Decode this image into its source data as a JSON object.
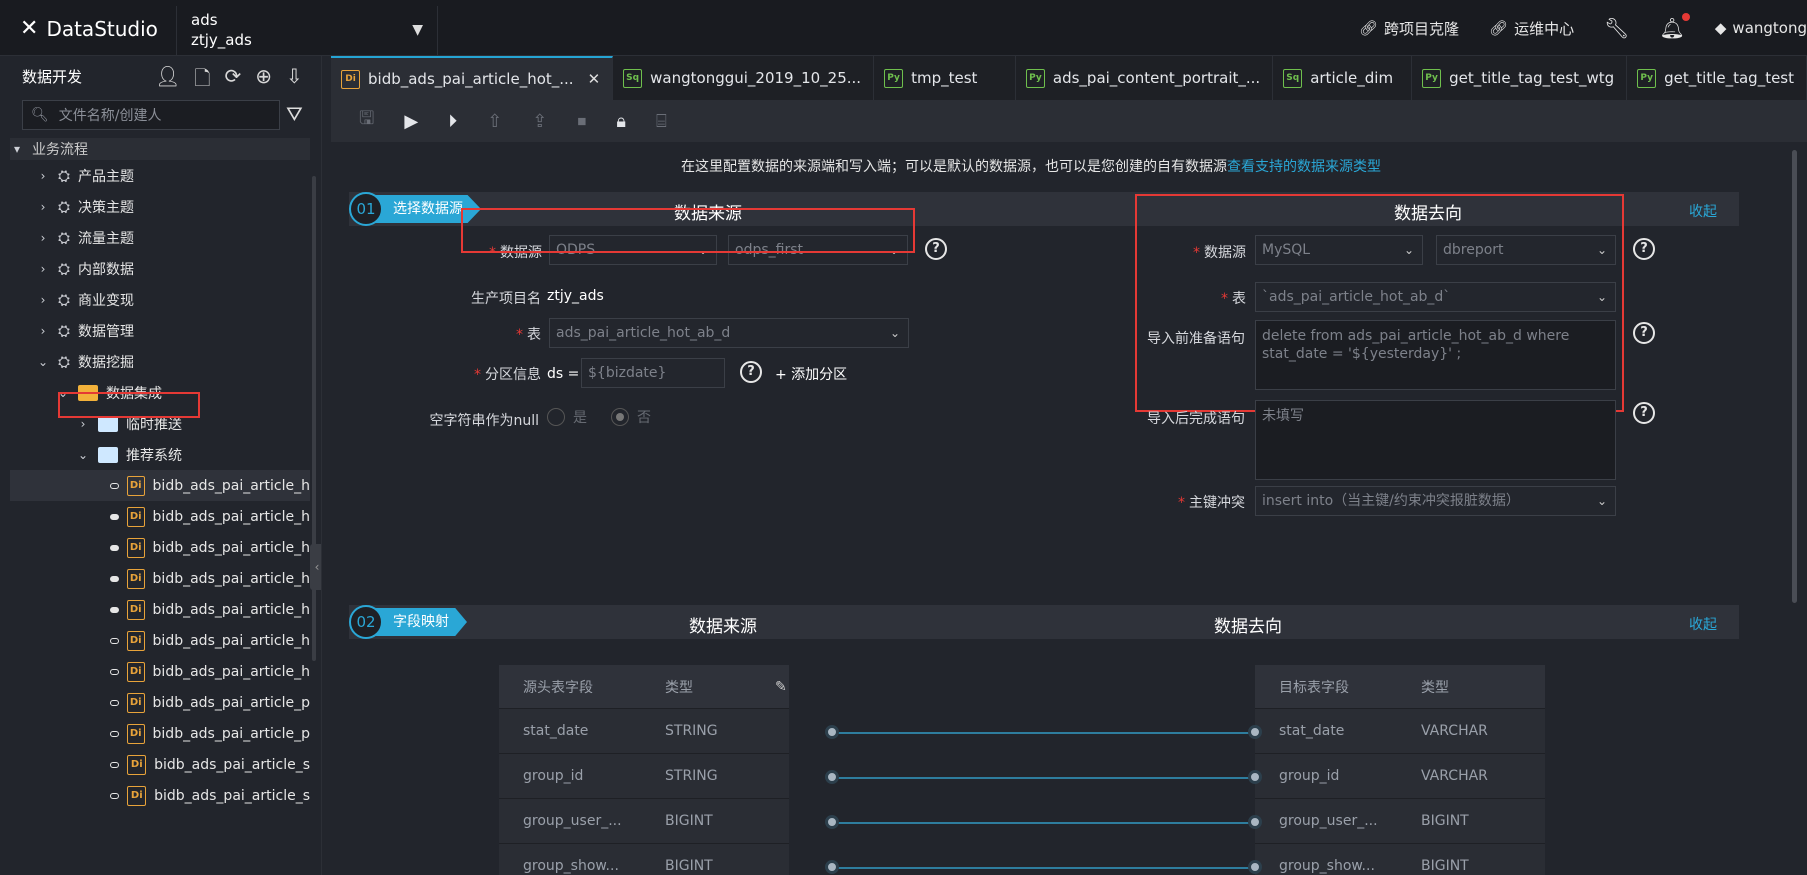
{
  "app": {
    "name": "DataStudio"
  },
  "project": {
    "line1": "ads",
    "line2": "ztjy_ads"
  },
  "topnav": {
    "clone": "跨项目克隆",
    "ops": "运维中心",
    "user": "wangtong"
  },
  "sidebar": {
    "title": "数据开发",
    "search_placeholder": "文件名称/创建人",
    "section": "业务流程",
    "items": [
      {
        "label": "产品主题"
      },
      {
        "label": "决策主题"
      },
      {
        "label": "流量主题"
      },
      {
        "label": "内部数据"
      },
      {
        "label": "商业变现"
      },
      {
        "label": "数据管理"
      },
      {
        "label": "数据挖掘"
      },
      {
        "label": "数据集成"
      },
      {
        "label": "临时推送"
      },
      {
        "label": "推荐系统"
      }
    ],
    "files": [
      "bidb_ads_pai_article_h",
      "bidb_ads_pai_article_h",
      "bidb_ads_pai_article_h",
      "bidb_ads_pai_article_h",
      "bidb_ads_pai_article_h",
      "bidb_ads_pai_article_h",
      "bidb_ads_pai_article_h",
      "bidb_ads_pai_article_p",
      "bidb_ads_pai_article_p",
      "bidb_ads_pai_article_s",
      "bidb_ads_pai_article_s"
    ]
  },
  "tabs": [
    {
      "badge": "Di",
      "label": "bidb_ads_pai_article_hot_..."
    },
    {
      "badge": "Sq",
      "label": "wangtonggui_2019_10_25..."
    },
    {
      "badge": "Py",
      "label": "tmp_test"
    },
    {
      "badge": "Py",
      "label": "ads_pai_content_portrait_..."
    },
    {
      "badge": "Sq",
      "label": "article_dim"
    },
    {
      "badge": "Py",
      "label": "get_title_tag_test_wtg"
    },
    {
      "badge": "Py",
      "label": "get_title_tag_test"
    }
  ],
  "intro": {
    "text": "在这里配置数据的来源端和写入端；可以是默认的数据源，也可以是您创建的自有数据源",
    "link": "查看支持的数据来源类型"
  },
  "section1": {
    "num": "01",
    "label": "选择数据源",
    "source_title": "数据来源",
    "target_title": "数据去向",
    "collapse": "收起",
    "source": {
      "ds_label": "数据源",
      "ds_type": "ODPS",
      "ds_name": "odps_first",
      "project_label": "生产项目名",
      "project_value": "ztjy_ads",
      "table_label": "表",
      "table_value": "ads_pai_article_hot_ab_d",
      "partition_label": "分区信息",
      "partition_prefix": "ds =",
      "partition_value": "${bizdate}",
      "add_partition": "+ 添加分区",
      "null_label": "空字符串作为null",
      "yes": "是",
      "no": "否"
    },
    "target": {
      "ds_label": "数据源",
      "ds_type": "MySQL",
      "ds_name": "dbreport",
      "table_label": "表",
      "table_value": "`ads_pai_article_hot_ab_d`",
      "pre_label": "导入前准备语句",
      "pre_value": "delete from ads_pai_article_hot_ab_d where stat_date = '${yesterday}' ;",
      "post_label": "导入后完成语句",
      "post_placeholder": "未填写",
      "conflict_label": "主键冲突",
      "conflict_value": "insert into（当主键/约束冲突报脏数据）"
    }
  },
  "section2": {
    "num": "02",
    "label": "字段映射",
    "source_title": "数据来源",
    "target_title": "数据去向",
    "collapse": "收起",
    "source_head": {
      "field": "源头表字段",
      "type": "类型"
    },
    "target_head": {
      "field": "目标表字段",
      "type": "类型"
    },
    "source_rows": [
      {
        "field": "stat_date",
        "type": "STRING"
      },
      {
        "field": "group_id",
        "type": "STRING"
      },
      {
        "field": "group_user_...",
        "type": "BIGINT"
      },
      {
        "field": "group_show...",
        "type": "BIGINT"
      }
    ],
    "target_rows": [
      {
        "field": "stat_date",
        "type": "VARCHAR"
      },
      {
        "field": "group_id",
        "type": "VARCHAR"
      },
      {
        "field": "group_user_...",
        "type": "BIGINT"
      },
      {
        "field": "group_show...",
        "type": "BIGINT"
      }
    ]
  }
}
